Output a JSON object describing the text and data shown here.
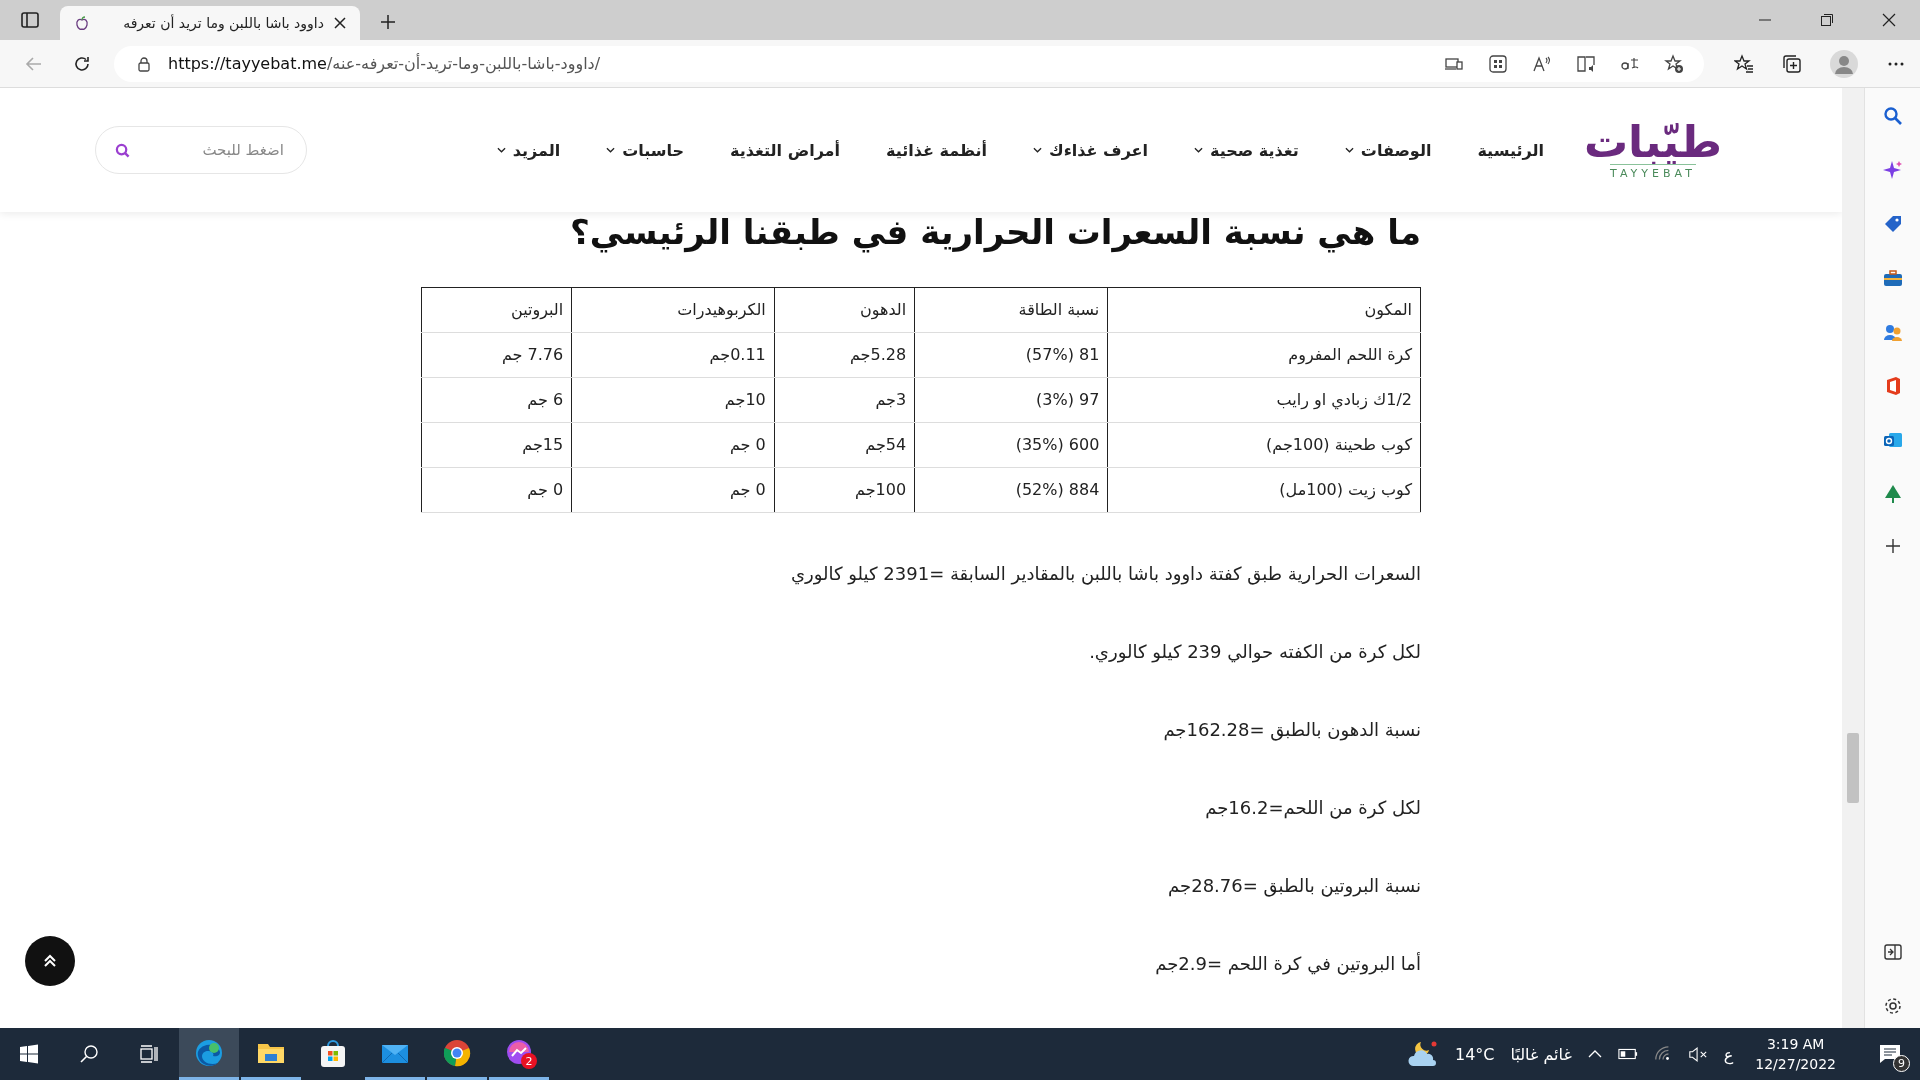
{
  "browser": {
    "tab": {
      "title": "داوود باشا باللبن وما تريد أن تعرفه"
    },
    "url": {
      "host": "https://tayyebat.me",
      "path": "/داوود-باشا-باللبن-وما-تريد-أن-تعرفه-عنه/"
    }
  },
  "site": {
    "logo": {
      "text": "طيّبات",
      "subtitle": "TAYYEBAT"
    },
    "nav": [
      {
        "label": "الرئيسية",
        "dropdown": false
      },
      {
        "label": "الوصفات",
        "dropdown": true
      },
      {
        "label": "تغذية صحية",
        "dropdown": true
      },
      {
        "label": "اعرف غذاءك",
        "dropdown": true
      },
      {
        "label": "أنظمة غذائية",
        "dropdown": false
      },
      {
        "label": "أمراض التغذية",
        "dropdown": false
      },
      {
        "label": "حاسبات",
        "dropdown": true
      },
      {
        "label": "المزيد",
        "dropdown": true
      }
    ],
    "search": {
      "placeholder": "اضغط للبحث"
    }
  },
  "article": {
    "heading": "ما هي نسبة السعرات الحرارية في طبقنا الرئيسي؟",
    "table": {
      "columns": [
        "المكون",
        "نسبة الطاقة",
        "الدهون",
        "الكربوهيدرات",
        "البروتين"
      ],
      "rows": [
        [
          "كرة اللحم المفروم",
          "81 (57%)",
          "5.28جم",
          "0.11جم",
          "7.76 جم"
        ],
        [
          "1/2ك زبادي او رايب",
          "97 (3%)",
          "3جم",
          "10جم",
          "6 جم"
        ],
        [
          "كوب طحينة (100جم)",
          "600 (35%)",
          "54جم",
          "0 جم",
          "15جم"
        ],
        [
          "كوب زيت (100مل)",
          "884 (52%)",
          "100جم",
          "0 جم",
          "0 جم"
        ]
      ]
    },
    "paragraphs": [
      "السعرات الحرارية طبق كفتة داوود باشا باللبن بالمقادير السابقة =2391 كيلو كالوري",
      "لكل كرة من الكفته حوالي 239 كيلو كالوري.",
      "نسبة الدهون بالطبق =162.28جم",
      "لكل كرة من اللحم=16.2جم",
      "نسبة البروتين بالطبق =28.76جم",
      "أما البروتين في كرة اللحم =2.9جم"
    ]
  },
  "taskbar": {
    "apps": [
      {
        "kind": "edge",
        "selected": true,
        "open": true
      },
      {
        "kind": "folder",
        "selected": false,
        "open": true
      },
      {
        "kind": "store",
        "selected": false,
        "open": false
      },
      {
        "kind": "mail",
        "selected": false,
        "open": true
      },
      {
        "kind": "chrome",
        "selected": false,
        "open": true
      },
      {
        "kind": "messenger",
        "selected": false,
        "open": true,
        "badge": "2"
      }
    ],
    "weather": {
      "temperature": "14°C",
      "condition": "غائم غالبًا"
    },
    "language": "ع",
    "time": "3:19 AM",
    "date": "12/27/2022",
    "notifications": "9"
  }
}
